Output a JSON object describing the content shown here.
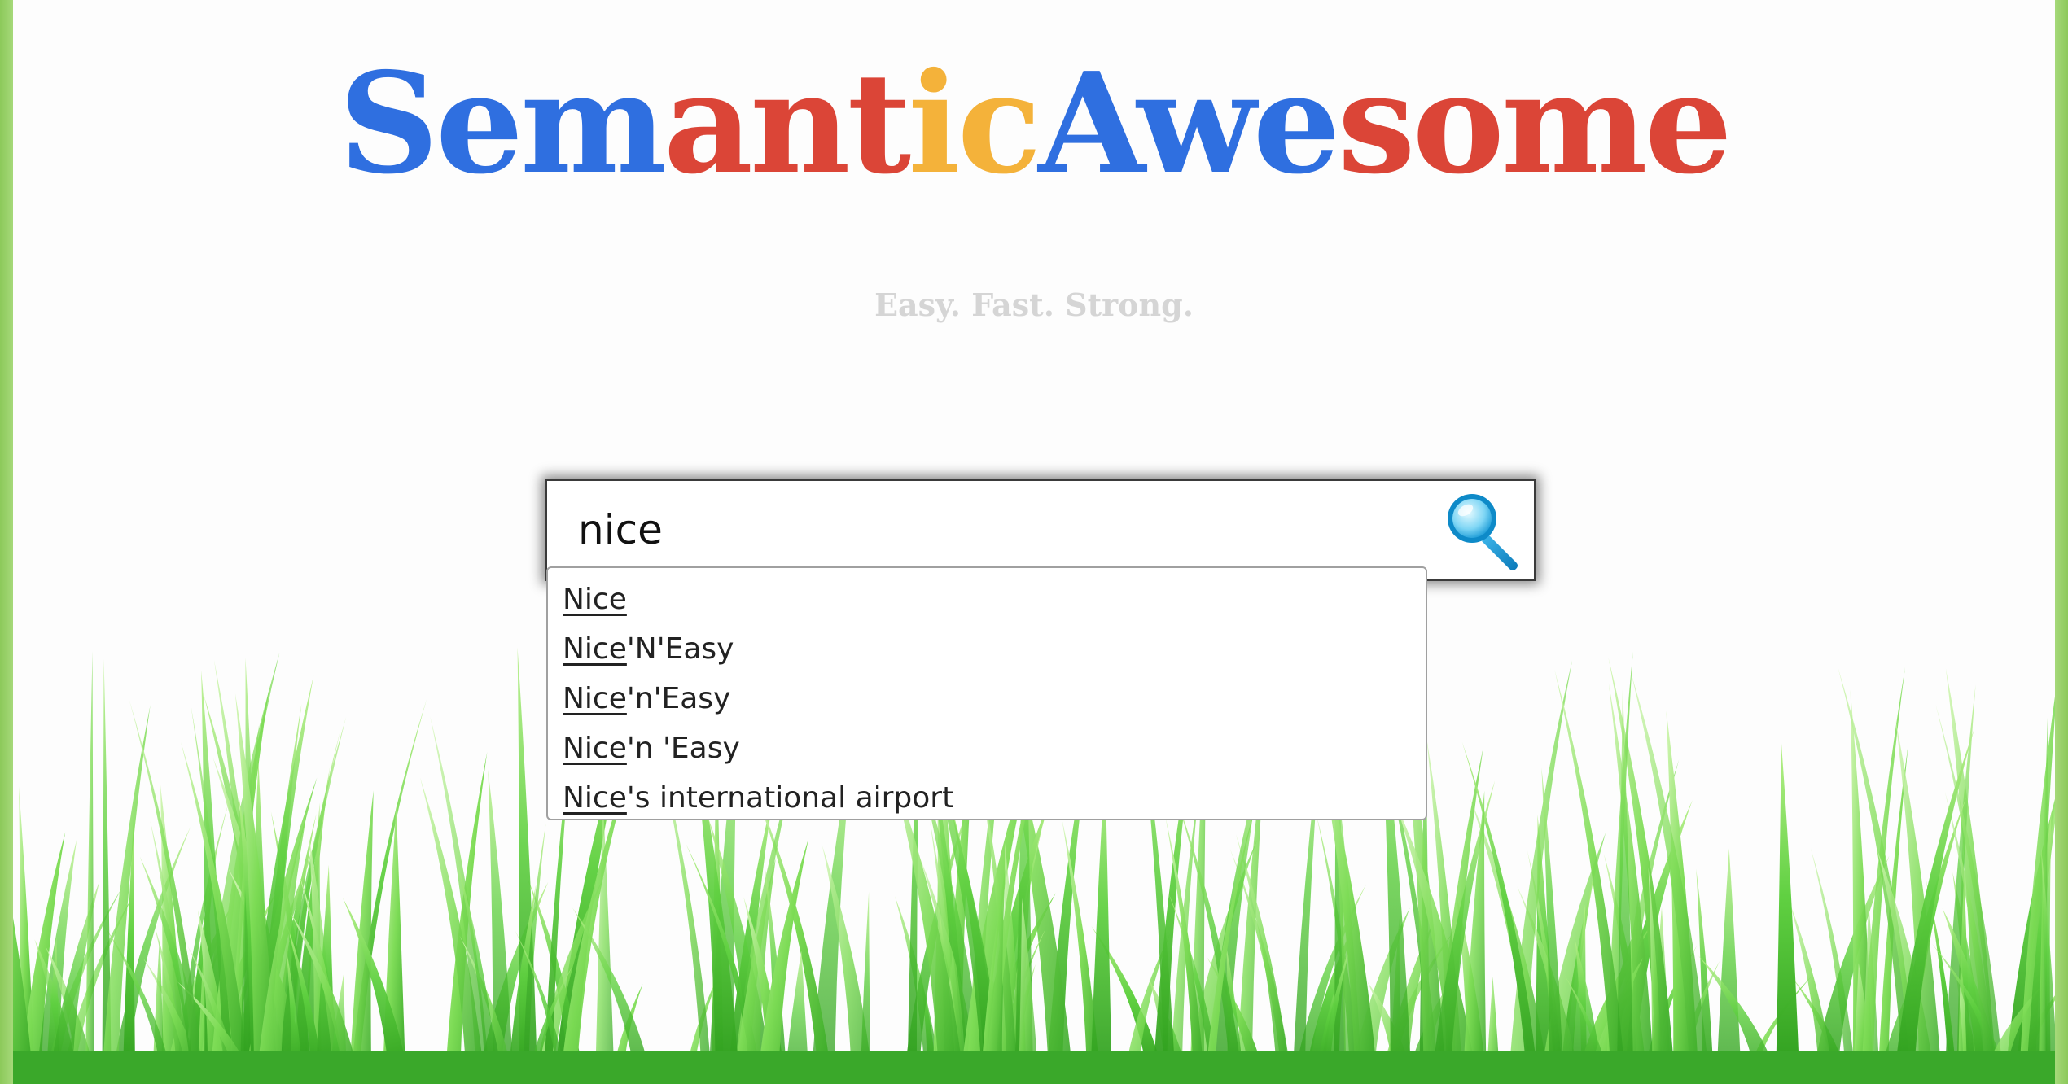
{
  "logo": {
    "parts": [
      {
        "text": "Sem",
        "color": "#2f6fe0"
      },
      {
        "text": "ant",
        "color": "#db4537"
      },
      {
        "text": "ic",
        "color": "#f4b23a"
      },
      {
        "text": "Awe",
        "color": "#2f6fe0"
      },
      {
        "text": "some",
        "color": "#db4537"
      }
    ]
  },
  "tagline": "Easy. Fast. Strong.",
  "search": {
    "value": "nice",
    "button_icon": "magnifier-icon"
  },
  "suggestions": [
    {
      "match": "Nice",
      "rest": ""
    },
    {
      "match": "Nice",
      "rest": "'N'Easy"
    },
    {
      "match": "Nice",
      "rest": "'n'Easy"
    },
    {
      "match": "Nice",
      "rest": "'n 'Easy"
    },
    {
      "match": "Nice",
      "rest": "'s international airport"
    }
  ],
  "colors": {
    "frame": "#8cc95a",
    "grass_light": "#9be36a",
    "grass_dark": "#2fa51f",
    "tagline": "#d5d5d5"
  }
}
